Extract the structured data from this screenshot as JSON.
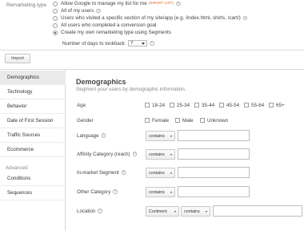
{
  "remarketing": {
    "label": "Remarketing type",
    "options": [
      {
        "label": "Allow Google to manage my list for me",
        "tag": "(SMART LIST)",
        "help": true,
        "selected": false
      },
      {
        "label": "All of my users",
        "help": true,
        "selected": false
      },
      {
        "label": "Users who visited a specific section of my site/app (e.g. /index.html, shirts, /cart/)",
        "help": true,
        "selected": false
      },
      {
        "label": "All users who completed a conversion goal",
        "help": false,
        "selected": false
      },
      {
        "label": "Create my own remarketing type using Segments",
        "help": false,
        "selected": true
      }
    ],
    "lookback_label": "Number of days to lookback",
    "lookback_value": "7",
    "help_glyph": "?"
  },
  "import_label": "Import",
  "sidebar": {
    "items": [
      "Demographics",
      "Technology",
      "Behavior",
      "Date of First Session",
      "Traffic Sources",
      "Ecommerce"
    ],
    "active": "Demographics",
    "advanced_heading": "Advanced",
    "advanced_items": [
      "Conditions",
      "Sequences"
    ]
  },
  "main": {
    "title": "Demographics",
    "subtitle": "Segment your users by demographic information.",
    "age": {
      "label": "Age",
      "options": [
        "18-24",
        "25-34",
        "35-44",
        "45-54",
        "55-64",
        "65+"
      ]
    },
    "gender": {
      "label": "Gender",
      "options": [
        "Female",
        "Male",
        "Unknown"
      ]
    },
    "language": {
      "label": "Language",
      "operator": "contains"
    },
    "affinity": {
      "label": "Affinity Category (reach)",
      "operator": "contains"
    },
    "inmarket": {
      "label": "In-market Segment",
      "operator": "contains"
    },
    "other": {
      "label": "Other Category",
      "operator": "contains"
    },
    "location": {
      "label": "Location",
      "scope": "Continent",
      "operator": "contains"
    }
  }
}
